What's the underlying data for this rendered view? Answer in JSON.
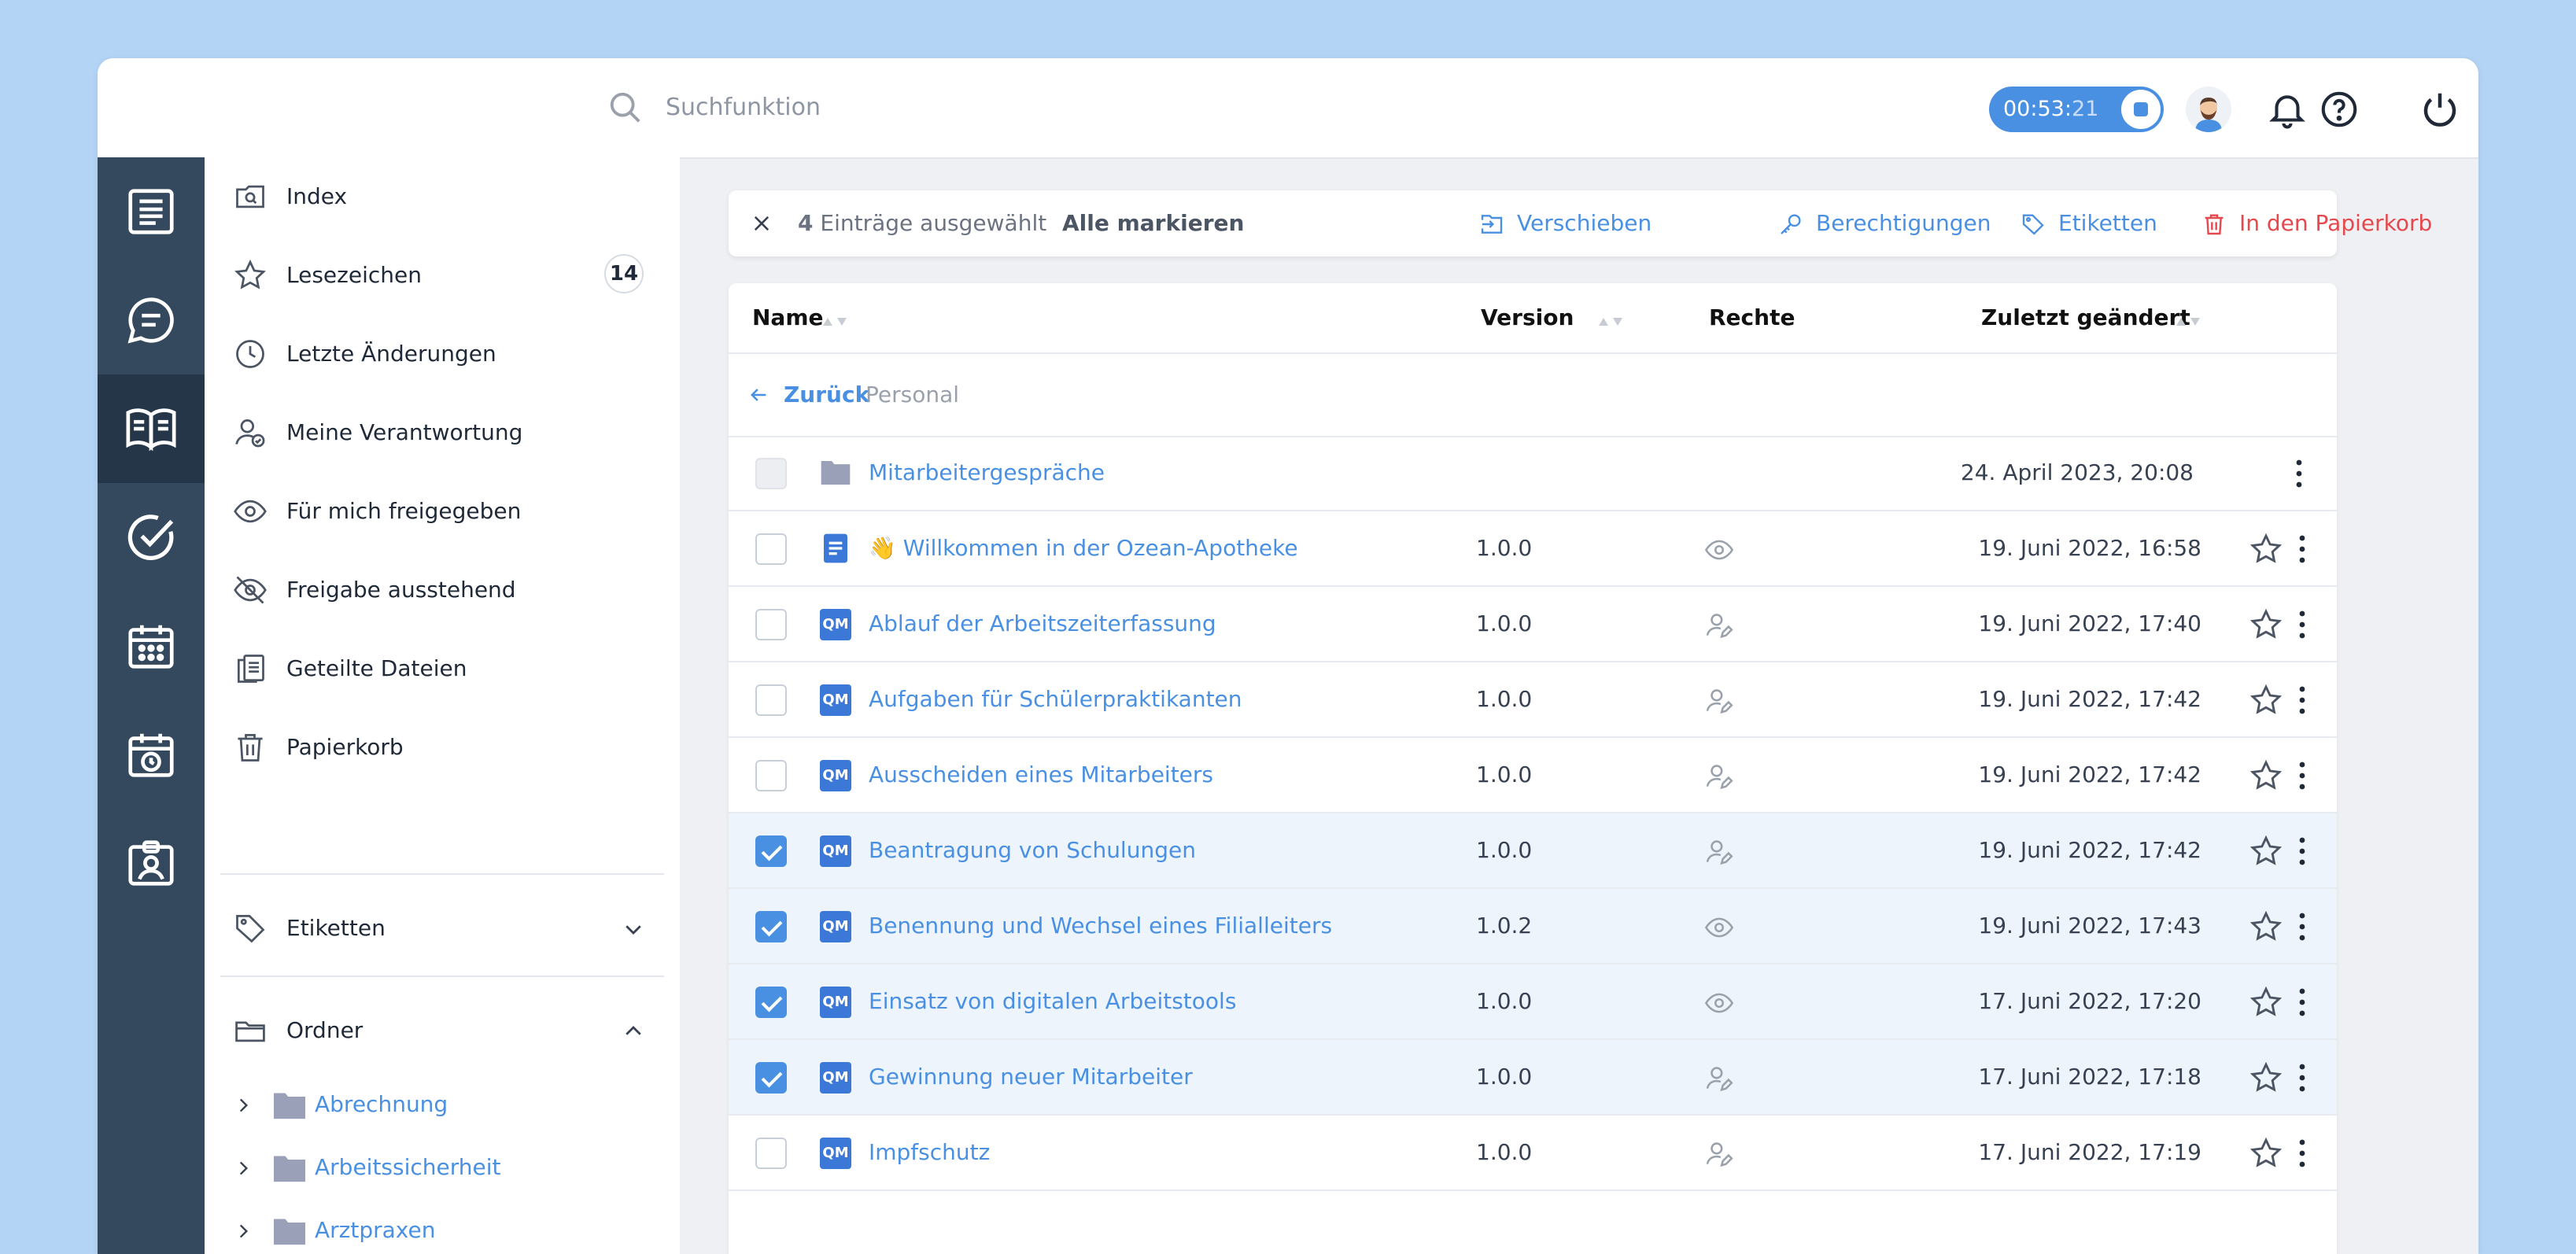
{
  "search": {
    "placeholder": "Suchfunktion"
  },
  "timer": {
    "hours": "00",
    "minutes": "53",
    "seconds": "21"
  },
  "sidebar": {
    "items": [
      {
        "label": "Index",
        "icon": "index-search-icon"
      },
      {
        "label": "Lesezeichen",
        "icon": "star-icon",
        "badge": "14"
      },
      {
        "label": "Letzte Änderungen",
        "icon": "clock-icon"
      },
      {
        "label": "Meine Verantwortung",
        "icon": "user-responsibility-icon"
      },
      {
        "label": "Für mich freigegeben",
        "icon": "eye-icon"
      },
      {
        "label": "Freigabe ausstehend",
        "icon": "eye-off-icon"
      },
      {
        "label": "Geteilte Dateien",
        "icon": "shared-files-icon"
      },
      {
        "label": "Papierkorb",
        "icon": "trash-icon"
      }
    ],
    "tags_label": "Etiketten",
    "folders_label": "Ordner",
    "folders": [
      "Abrechnung",
      "Arbeitssicherheit",
      "Arztpraxen"
    ]
  },
  "selection": {
    "count": "4",
    "text": "Einträge ausgewählt",
    "select_all": "Alle markieren",
    "actions": {
      "move": "Verschieben",
      "permissions": "Berechtigungen",
      "tags": "Etiketten",
      "trash": "In den Papierkorb"
    }
  },
  "table": {
    "headers": {
      "name": "Name",
      "version": "Version",
      "rights": "Rechte",
      "modified": "Zuletzt geändert"
    },
    "back_label": "Zurück",
    "current_folder": "Personal",
    "rows": [
      {
        "type": "folder",
        "name": "Mitarbeitergespräche",
        "version": "",
        "rights": "",
        "date": "24. April 2023, 20:08",
        "checked": false,
        "disabled": true
      },
      {
        "type": "doc",
        "name": "👋 Willkommen in der Ozean-Apotheke",
        "version": "1.0.0",
        "rights": "eye",
        "date": "19. Juni 2022, 16:58",
        "checked": false
      },
      {
        "type": "qm",
        "name": "Ablauf der Arbeitszeiterfassung",
        "version": "1.0.0",
        "rights": "user-edit",
        "date": "19. Juni 2022, 17:40",
        "checked": false
      },
      {
        "type": "qm",
        "name": "Aufgaben für Schülerpraktikanten",
        "version": "1.0.0",
        "rights": "user-edit",
        "date": "19. Juni 2022, 17:42",
        "checked": false
      },
      {
        "type": "qm",
        "name": "Ausscheiden eines Mitarbeiters",
        "version": "1.0.0",
        "rights": "user-edit",
        "date": "19. Juni 2022, 17:42",
        "checked": false
      },
      {
        "type": "qm",
        "name": "Beantragung von Schulungen",
        "version": "1.0.0",
        "rights": "user-edit",
        "date": "19. Juni 2022, 17:42",
        "checked": true
      },
      {
        "type": "qm",
        "name": "Benennung und Wechsel eines Filialleiters",
        "version": "1.0.2",
        "rights": "eye",
        "date": "19. Juni 2022, 17:43",
        "checked": true
      },
      {
        "type": "qm",
        "name": "Einsatz von digitalen Arbeitstools",
        "version": "1.0.0",
        "rights": "eye",
        "date": "17. Juni 2022, 17:20",
        "checked": true
      },
      {
        "type": "qm",
        "name": "Gewinnung neuer Mitarbeiter",
        "version": "1.0.0",
        "rights": "user-edit",
        "date": "17. Juni 2022, 17:18",
        "checked": true
      },
      {
        "type": "qm",
        "name": "Impfschutz",
        "version": "1.0.0",
        "rights": "user-edit",
        "date": "17. Juni 2022, 17:19",
        "checked": false
      }
    ],
    "qm_label": "QM"
  },
  "colors": {
    "accent": "#4a90e2",
    "danger": "#e5484d",
    "rail": "#34495e",
    "rail_active": "#243648",
    "background": "#b3d4f5"
  }
}
